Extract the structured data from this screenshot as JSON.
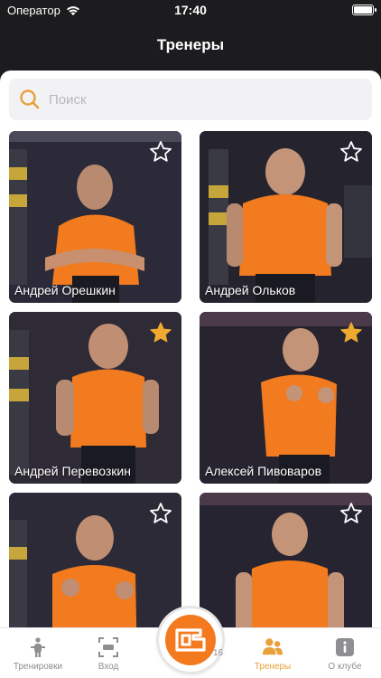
{
  "status": {
    "carrier": "Оператор",
    "time": "17:40"
  },
  "nav": {
    "title": "Тренеры"
  },
  "search": {
    "placeholder": "Поиск"
  },
  "trainers": [
    {
      "name": "Андрей Орешкин",
      "favorite": false
    },
    {
      "name": "Андрей Ольков",
      "favorite": false
    },
    {
      "name": "Андрей Перевозкин",
      "favorite": true
    },
    {
      "name": "Алексей Пивоваров",
      "favorite": true
    },
    {
      "name": "",
      "favorite": false
    },
    {
      "name": "",
      "favorite": false
    }
  ],
  "tabs": [
    {
      "label": "Тренировки",
      "icon": "dumbbell-person-icon",
      "active": false
    },
    {
      "label": "Вход",
      "icon": "qr-scan-icon",
      "active": false
    },
    {
      "label": "Тренеры",
      "icon": "trainers-icon",
      "active": true
    },
    {
      "label": "О клубе",
      "icon": "info-icon",
      "active": false
    }
  ],
  "center_tab": {
    "icon": "club-logo-icon",
    "partial_text": "16"
  },
  "colors": {
    "accent": "#e8a13a",
    "brand_orange": "#f47a20",
    "star_gold": "#f0a92f"
  }
}
